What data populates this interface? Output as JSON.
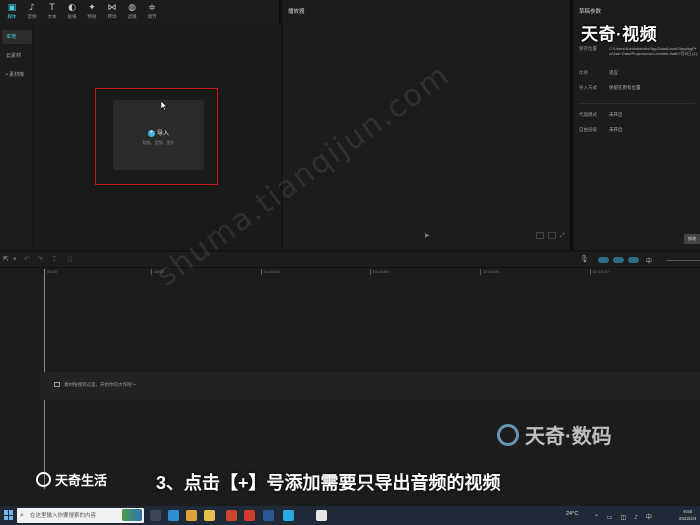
{
  "toolbar": {
    "items": [
      {
        "icon": "media-icon",
        "glyph": "▣",
        "label": "媒体",
        "active": true
      },
      {
        "icon": "audio-icon",
        "glyph": "♪",
        "label": "音频"
      },
      {
        "icon": "text-icon",
        "glyph": "T",
        "label": "文本"
      },
      {
        "icon": "sticker-icon",
        "glyph": "◐",
        "label": "贴纸"
      },
      {
        "icon": "effects-icon",
        "glyph": "✦",
        "label": "特效"
      },
      {
        "icon": "transition-icon",
        "glyph": "⋈",
        "label": "转场"
      },
      {
        "icon": "filter-icon",
        "glyph": "◍",
        "label": "滤镜"
      },
      {
        "icon": "adjust-icon",
        "glyph": "≑",
        "label": "调节"
      }
    ]
  },
  "sidebar": {
    "items": [
      {
        "label": "本地",
        "active": true
      },
      {
        "label": "云素材"
      },
      {
        "label": "• 素材库"
      }
    ]
  },
  "media": {
    "import_label": "导入",
    "import_hint": "视频、音频、图片"
  },
  "player": {
    "title": "播放器",
    "play_glyph": "▶"
  },
  "params": {
    "title": "草稿参数",
    "rows": [
      {
        "label": "保存位置",
        "value": "C:/Users/Administrator/AppData/Local/JianyingPro/User Data/Projects/com.lveditor.draft/7月9日 (1)"
      },
      {
        "label": "比例",
        "value": "适应"
      },
      {
        "label": "导入方式",
        "value": "保留在原有位置"
      },
      {
        "label": "代理模式",
        "value": "未开启"
      },
      {
        "label": "自由层级",
        "value": "未开启"
      }
    ],
    "export_label": "修改"
  },
  "brand_top": "天奇·视频",
  "timeline": {
    "ruler_ticks": [
      "00:00",
      "10:00",
      "01:00:00",
      "01:10:00",
      "02:00:00",
      "02:10:00"
    ],
    "track_hint": "素材拖拽到这里，开始你的大作吧～",
    "lang_label": "中"
  },
  "watermark": "shuma.tianqijun.com",
  "brand_bottom": "天奇·数码",
  "logo_left": "天奇生活",
  "caption": "3、点击【+】号添加需要只导出音频的视频",
  "taskbar": {
    "search_placeholder": "在这里输入你要搜索的内容",
    "temperature": "24°C",
    "clock_time": "9:50",
    "clock_date": "2022/2/4",
    "apps": [
      {
        "name": "task-view-icon",
        "color": "#3a4656"
      },
      {
        "name": "edge-icon",
        "color": "#2b8fd6"
      },
      {
        "name": "chrome-icon",
        "color": "#e0a23a"
      },
      {
        "name": "explorer-icon",
        "color": "#e3c04c"
      },
      {
        "name": "store-icon",
        "color": "#c9472f"
      },
      {
        "name": "wps-icon",
        "color": "#d23b2b"
      },
      {
        "name": "word-icon",
        "color": "#2b5797"
      },
      {
        "name": "qq-icon",
        "color": "#2aa9e0"
      },
      {
        "name": "capcut-icon",
        "color": "#e6e6e6"
      }
    ]
  },
  "colors": {
    "accent": "#3fd6e0",
    "highlight_border": "#c8161d",
    "panel_bg": "#1c1c1c",
    "taskbar_bg": "#1f2a36"
  }
}
